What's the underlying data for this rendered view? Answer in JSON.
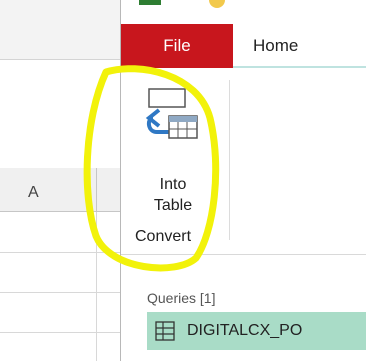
{
  "ribbon": {
    "tabs": [
      {
        "label": "File",
        "color": "#c8161d"
      },
      {
        "label": "Home"
      }
    ],
    "command": {
      "label_line1": "Into",
      "label_line2": "Table",
      "icon": "into-table-icon"
    },
    "group_label": "Convert"
  },
  "sheet": {
    "column_label": "A"
  },
  "queries": {
    "header": "Queries [1]",
    "items": [
      {
        "label": "DIGITALCX_PO",
        "icon": "table-grid-icon",
        "selected": true,
        "color": "#a9dcc7"
      }
    ]
  },
  "annotation": {
    "color": "#f2f20a",
    "shape": "hand-drawn-ellipse"
  }
}
